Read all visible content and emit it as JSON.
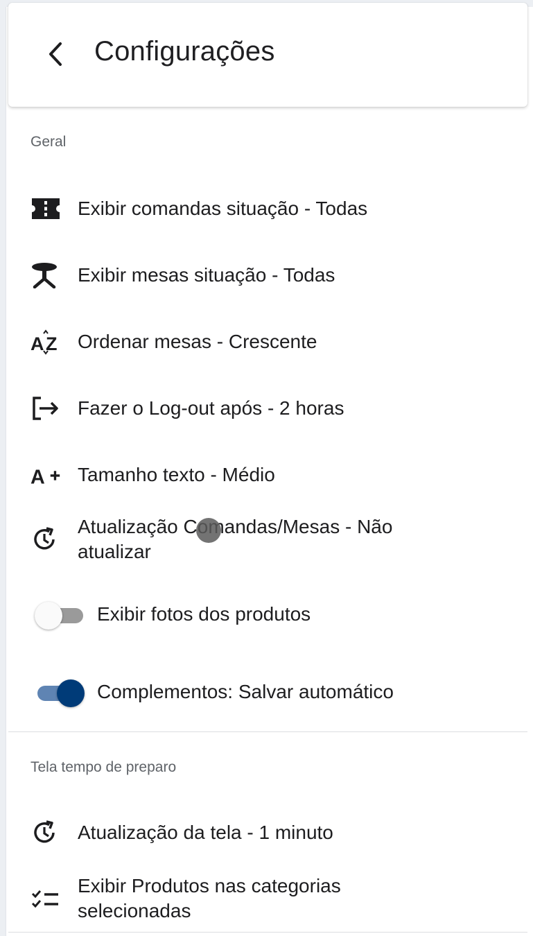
{
  "header": {
    "title": "Configurações",
    "back_icon": "chevron-left-icon"
  },
  "sections": [
    {
      "label": "Geral",
      "items": [
        {
          "icon": "ticket-icon",
          "label": "Exibir comandas situação - Todas"
        },
        {
          "icon": "table-icon",
          "label": "Exibir mesas situação - Todas"
        },
        {
          "icon": "sort-az-icon",
          "label": "Ordenar mesas - Crescente"
        },
        {
          "icon": "logout-icon",
          "label": "Fazer o Log-out após - 2 horas"
        },
        {
          "icon": "text-size-icon",
          "label": "Tamanho texto - Médio"
        },
        {
          "icon": "refresh-clock-icon",
          "label": "Atualização Comandas/Mesas - Não atualizar"
        }
      ],
      "toggles": [
        {
          "label": "Exibir fotos dos produtos",
          "checked": false
        },
        {
          "label": "Complementos: Salvar automático",
          "checked": true
        }
      ]
    },
    {
      "label": "Tela tempo de preparo",
      "items": [
        {
          "icon": "refresh-clock-icon",
          "label": "Atualização da tela - 1 minuto"
        },
        {
          "icon": "checklist-icon",
          "label": "Exibir Produtos nas categorias selecionadas"
        }
      ]
    }
  ],
  "colors": {
    "toggle_on_thumb": "#003b78",
    "toggle_on_track": "#5f84b3",
    "toggle_off_track": "#9a9a9a"
  }
}
